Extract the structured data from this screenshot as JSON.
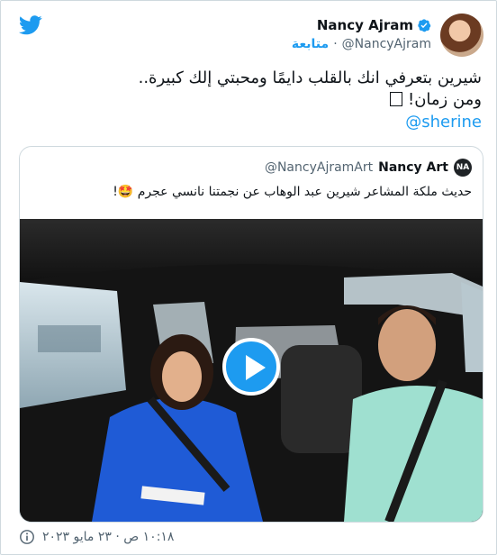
{
  "author": {
    "name": "Nancy Ajram",
    "handle": "@NancyAjram",
    "follow_label": "متابعة",
    "separator": "·"
  },
  "tweet": {
    "line1": "شيرين بتعرفي انك بالقلب دايمًا ومحبتي إلك كبيرة..",
    "line2": "ومن زمان!",
    "mention": "@sherine"
  },
  "quoted": {
    "name": "Nancy Art",
    "handle": "@NancyAjramArt",
    "avatar_text": "NA",
    "text": "حديث ملكة المشاعر شيرين عبد الوهاب عن نجمتنا نانسي عجرم 🤩!"
  },
  "footer": {
    "timestamp": "١٠:١٨ ص · ٢٣ مايو ٢٠٢٣"
  },
  "colors": {
    "brand": "#1d9bf0",
    "muted": "#536471",
    "text": "#0f1419"
  },
  "icons": [
    "twitter-logo-icon",
    "verified-badge-icon",
    "play-icon",
    "info-icon"
  ]
}
